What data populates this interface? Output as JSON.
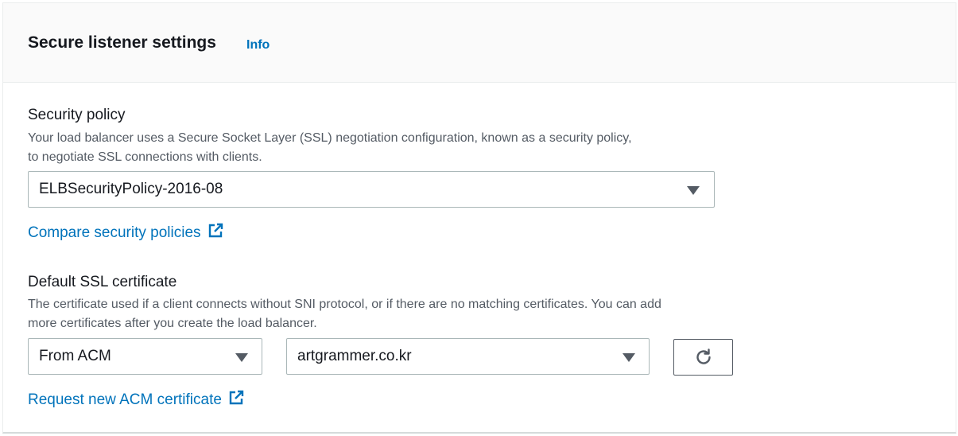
{
  "header": {
    "title": "Secure listener settings",
    "info_label": "Info"
  },
  "security_policy": {
    "label": "Security policy",
    "description_line1": "Your load balancer uses a Secure Socket Layer (SSL) negotiation configuration, known as a security policy,",
    "description_line2": "to negotiate SSL connections with clients.",
    "selected": "ELBSecurityPolicy-2016-08",
    "compare_link": "Compare security policies"
  },
  "ssl_certificate": {
    "label": "Default SSL certificate",
    "description_line1": "The certificate used if a client connects without SNI protocol, or if there are no matching certificates. You can add",
    "description_line2": "more certificates after you create the load balancer.",
    "source_selected": "From ACM",
    "certificate_selected": "artgrammer.co.kr",
    "request_link": "Request new ACM certificate"
  },
  "icons": {
    "external": "external-link-icon",
    "dropdown": "caret-down-icon",
    "refresh": "refresh-icon"
  },
  "colors": {
    "link": "#0073bb",
    "text": "#16191f",
    "muted": "#545b64",
    "header_bg": "#fafafa"
  }
}
